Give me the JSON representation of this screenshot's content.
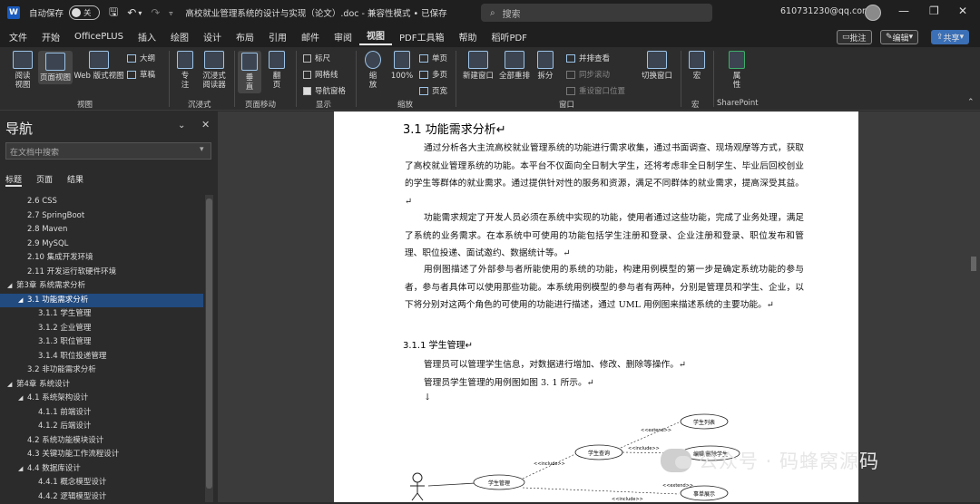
{
  "titlebar": {
    "autosave_label": "自动保存",
    "autosave_state": "关",
    "doc_title": "高校就业管理系统的设计与实现（论文）.doc - 兼容性模式 • 已保存",
    "search_placeholder": "搜索",
    "account": "610731230@qq.com"
  },
  "menu": [
    "文件",
    "开始",
    "OfficePLUS",
    "插入",
    "绘图",
    "设计",
    "布局",
    "引用",
    "邮件",
    "审阅",
    "视图",
    "PDF工具箱",
    "帮助",
    "稻听PDF"
  ],
  "menu_actions": {
    "comments": "批注",
    "edit": "编辑",
    "share": "共享"
  },
  "ribbon": {
    "read_mode": "阅读\n视图",
    "print_layout": "页面视图",
    "web_layout": "Web 版式视图",
    "outline": "大纲",
    "draft": "草稿",
    "focus": "专\n注",
    "immersive_reader": "沉浸式\n阅读器",
    "vertical": "垂\n直",
    "side_by_side": "翻\n页",
    "ruler": "标尺",
    "gridlines": "网格线",
    "nav_pane": "导航窗格",
    "zoom": "缩\n放",
    "zoom_100": "100%",
    "one_page": "单页",
    "multi_page": "多页",
    "page_width": "页宽",
    "new_window": "新建窗口",
    "arrange_all": "全部重排",
    "split": "拆分",
    "view_side_by_side": "并排查看",
    "sync_scrolling": "同步滚动",
    "reset_window": "重设窗口位置",
    "switch_windows": "切换窗口",
    "macros": "宏",
    "properties": "属\n性",
    "groups": {
      "views": "视图",
      "immersive": "沉浸式",
      "page_movement": "页面移动",
      "show": "显示",
      "zoom": "缩放",
      "window": "窗口",
      "macros": "宏",
      "sharepoint": "SharePoint"
    }
  },
  "nav": {
    "title": "导航",
    "search_placeholder": "在文档中搜索",
    "tabs": [
      "标题",
      "页面",
      "结果"
    ],
    "items": [
      {
        "text": "2.6  CSS",
        "level": 2,
        "tri": ""
      },
      {
        "text": "2.7 SpringBoot",
        "level": 2,
        "tri": ""
      },
      {
        "text": "2.8   Maven",
        "level": 2,
        "tri": ""
      },
      {
        "text": "2.9  MySQL",
        "level": 2,
        "tri": ""
      },
      {
        "text": "2.10  集成开发环境",
        "level": 2,
        "tri": ""
      },
      {
        "text": "2.11  开发运行软硬件环境",
        "level": 2,
        "tri": ""
      },
      {
        "text": "第3章 系统需求分析",
        "level": 1,
        "tri": "◢"
      },
      {
        "text": "3.1  功能需求分析",
        "level": 2,
        "tri": "◢",
        "selected": true
      },
      {
        "text": "3.1.1  学生管理",
        "level": 3,
        "tri": ""
      },
      {
        "text": "3.1.2  企业管理",
        "level": 3,
        "tri": ""
      },
      {
        "text": "3.1.3  职位管理",
        "level": 3,
        "tri": ""
      },
      {
        "text": "3.1.4  职位投递管理",
        "level": 3,
        "tri": ""
      },
      {
        "text": "3.2  非功能需求分析",
        "level": 2,
        "tri": ""
      },
      {
        "text": "第4章 系统设计",
        "level": 1,
        "tri": "◢"
      },
      {
        "text": "4.1  系统架构设计",
        "level": 2,
        "tri": "◢"
      },
      {
        "text": "4.1.1  前端设计",
        "level": 3,
        "tri": ""
      },
      {
        "text": "4.1.2  后端设计",
        "level": 3,
        "tri": ""
      },
      {
        "text": "4.2  系统功能模块设计",
        "level": 2,
        "tri": ""
      },
      {
        "text": "4.3  关键功能工作流程设计",
        "level": 2,
        "tri": ""
      },
      {
        "text": "4.4  数据库设计",
        "level": 2,
        "tri": "◢"
      },
      {
        "text": "4.4.1  概念模型设计",
        "level": 3,
        "tri": ""
      },
      {
        "text": "4.4.2  逻辑模型设计",
        "level": 3,
        "tri": ""
      }
    ]
  },
  "document": {
    "heading": "3.1   功能需求分析↵",
    "p1": "通过分析各大主流高校就业管理系统的功能进行需求收集，通过书面调查、现场观摩等方式，获取了高校就业管理系统的功能。本平台不仅面向全日制大学生，还将考虑非全日制学生、毕业后回校创业的学生等群体的就业需求。通过提供针对性的服务和资源，满足不同群体的就业需求，提高深受其益。↵",
    "p2": "功能需求规定了开发人员必须在系统中实现的功能，使用者通过这些功能，完成了业务处理，满足了系统的业务需求。在本系统中可使用的功能包括学生注册和登录、企业注册和登录、职位发布和管理、职位投递、面试邀约、数据统计等。↵",
    "p3": "用例图描述了外部参与者所能使用的系统的功能，构建用例模型的第一步是确定系统功能的参与者，参与者具体可以使用那些功能。本系统用例模型的参与者有两种，分别是管理员和学生、企业，以下将分别对这两个角色的可使用的功能进行描述，通过 UML 用例图来描述系统的主要功能。↵",
    "subheading": "3.1.1    学生管理↵",
    "line1": "管理员可以管理学生信息，对数据进行增加、修改、删除等操作。↵",
    "line2": "管理员学生管理的用例图如图 3. 1 所示。↵",
    "arrow": "↓",
    "uml": {
      "actor_use": "学生管理",
      "query": "学生查询",
      "list": "学生列表",
      "edit": "编辑/删除学生",
      "show": "事单展示",
      "include1": "<<include>>",
      "include2": "<<include>>",
      "extend1": "<<extend>>",
      "extend2": "<<extend>>",
      "include3": "<<include>>"
    }
  },
  "watermark": "公众号 · 码蜂窝源码"
}
